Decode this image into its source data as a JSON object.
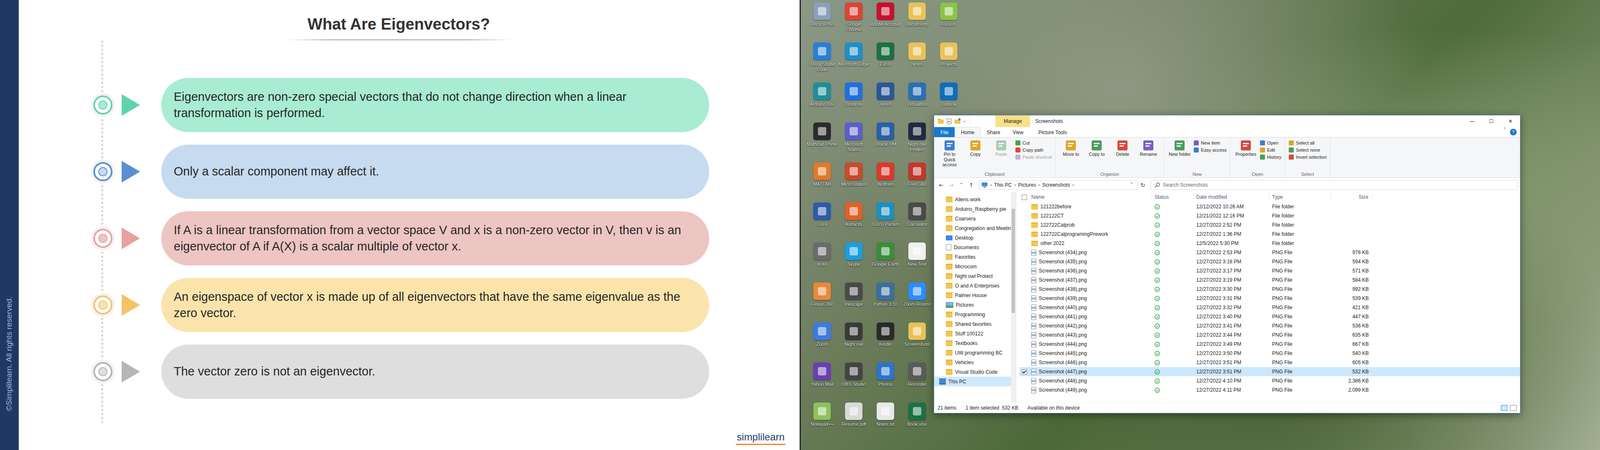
{
  "slide": {
    "title": "What Are Eigenvectors?",
    "watermark": "©Simplilearn. All rights reserved.",
    "logo": "simplilearn",
    "points": [
      {
        "text": "Eigenvectors are non-zero special vectors that do not change direction when a linear transformation is performed.",
        "color": "#a8ecd3",
        "accent": "#5fd3ae"
      },
      {
        "text": "Only a scalar component may affect it.",
        "color": "#c6daf0",
        "accent": "#5a8fd2"
      },
      {
        "text": "If A is a linear transformation from a vector space V and x is a non-zero vector in V, then v is an eigenvector of A if A(X) is a scalar multiple of vector x.",
        "color": "#edc5c2",
        "accent": "#e6a29d"
      },
      {
        "text": "An eigenspace of vector x is made up of all eigenvectors that have the same eigenvalue as the zero vector.",
        "color": "#fbe4ab",
        "accent": "#f5c265"
      },
      {
        "text": "The vector zero is not an eigenvector.",
        "color": "#dedede",
        "accent": "#b5b5b5"
      }
    ]
  },
  "desktop": {
    "icons": [
      {
        "label": "Recycle Bin",
        "color": "#8aa0b8"
      },
      {
        "label": "Visual Studio Code",
        "color": "#2a7fd4"
      },
      {
        "label": "Arduino IDE",
        "color": "#1f8f95"
      },
      {
        "label": "Mathcad Prime",
        "color": "#2b2b2b"
      },
      {
        "label": "MATLAB",
        "color": "#e07a28"
      },
      {
        "label": "Cura",
        "color": "#2f5aa8"
      },
      {
        "label": "Krita",
        "color": "#6b6b6b"
      },
      {
        "label": "Fusion 360",
        "color": "#e8893a"
      },
      {
        "label": "Zoom",
        "color": "#3d7be0"
      },
      {
        "label": "Yahoo Mail",
        "color": "#6b3fb0"
      },
      {
        "label": "Notepad++",
        "color": "#8fc15a"
      },
      {
        "label": "Google Chrome",
        "color": "#db4437"
      },
      {
        "label": "Microsoft Edge",
        "color": "#1e8fc8"
      },
      {
        "label": "Dropbox",
        "color": "#1f6fe0"
      },
      {
        "label": "Microsoft Teams",
        "color": "#5b5fc7"
      },
      {
        "label": "MicroStation",
        "color": "#c94a2c"
      },
      {
        "label": "Audacity",
        "color": "#e0602a"
      },
      {
        "label": "Skype",
        "color": "#18a0e0"
      },
      {
        "label": "Inkscape",
        "color": "#4a4a4a"
      },
      {
        "label": "Night owl",
        "color": "#3a3a3a"
      },
      {
        "label": "OBS Studio",
        "color": "#444444"
      },
      {
        "label": "Resume.pdf",
        "color": "#d9d9d9"
      },
      {
        "label": "Adobe Acrobat",
        "color": "#c8102e"
      },
      {
        "label": "Excel",
        "color": "#1d7044"
      },
      {
        "label": "Word",
        "color": "#2b5797"
      },
      {
        "label": "Oracle VM",
        "color": "#2a5ea8"
      },
      {
        "label": "Wolfram",
        "color": "#d93a2b"
      },
      {
        "label": "Cisco Packet",
        "color": "#1c8fc0"
      },
      {
        "label": "Google Earth",
        "color": "#3b8d3e"
      },
      {
        "label": "Python 3.10",
        "color": "#3b6fa0"
      },
      {
        "label": "Kindle",
        "color": "#2a2a2a"
      },
      {
        "label": "Photos",
        "color": "#2f73c9"
      },
      {
        "label": "Notes.txt",
        "color": "#e8e8e8"
      },
      {
        "label": "Documents",
        "color": "#e8c25a"
      },
      {
        "label": "Notes",
        "color": "#e8c25a"
      },
      {
        "label": "VirtualBox",
        "color": "#2a6fb5"
      },
      {
        "label": "Night owl Protect",
        "color": "#1f2a44"
      },
      {
        "label": "FreeCAD",
        "color": "#c0392b"
      },
      {
        "label": "Calculator",
        "color": "#4a4a4a"
      },
      {
        "label": "New Text",
        "color": "#f0f0f0"
      },
      {
        "label": "Zoom Rooms",
        "color": "#2d8cff"
      },
      {
        "label": "Screenshots",
        "color": "#e8c25a"
      },
      {
        "label": "Recorder",
        "color": "#5a5a5a"
      },
      {
        "label": "Book.xlsx",
        "color": "#1d7044"
      },
      {
        "label": "Fusion",
        "color": "#8bc34a"
      },
      {
        "label": "Projects",
        "color": "#e8c25a"
      },
      {
        "label": "Outlook",
        "color": "#0f6cbd"
      }
    ]
  },
  "explorer": {
    "context_tab": "Manage",
    "title": "Screenshots",
    "controls": [
      "—",
      "☐",
      "✕"
    ],
    "tabs": [
      {
        "label": "File",
        "kind": "file",
        "selected": false
      },
      {
        "label": "Home",
        "kind": "normal",
        "selected": true
      },
      {
        "label": "Share",
        "kind": "normal",
        "selected": false
      },
      {
        "label": "View",
        "kind": "normal",
        "selected": false
      },
      {
        "label": "Picture Tools",
        "kind": "context",
        "selected": false
      }
    ],
    "ribbon_toggle": "˄",
    "help": "?",
    "ribbon": [
      {
        "label": "Clipboard",
        "items": [
          {
            "label": "Pin to Quick access",
            "kind": "large",
            "disabled": false
          },
          {
            "label": "Copy",
            "kind": "large",
            "disabled": false
          },
          {
            "label": "Paste",
            "kind": "large",
            "disabled": true
          },
          {
            "label": "Cut",
            "kind": "small",
            "disabled": false
          },
          {
            "label": "Copy path",
            "kind": "small",
            "disabled": false
          },
          {
            "label": "Paste shortcut",
            "kind": "small",
            "disabled": true
          }
        ]
      },
      {
        "label": "Organize",
        "items": [
          {
            "label": "Move to",
            "kind": "large",
            "disabled": false
          },
          {
            "label": "Copy to",
            "kind": "large",
            "disabled": false
          },
          {
            "label": "Delete",
            "kind": "large",
            "disabled": false
          },
          {
            "label": "Rename",
            "kind": "large",
            "disabled": false
          }
        ]
      },
      {
        "label": "New",
        "items": [
          {
            "label": "New folder",
            "kind": "large",
            "disabled": false
          },
          {
            "label": "New item",
            "kind": "small",
            "disabled": false
          },
          {
            "label": "Easy access",
            "kind": "small",
            "disabled": false
          }
        ]
      },
      {
        "label": "Open",
        "items": [
          {
            "label": "Properties",
            "kind": "large",
            "disabled": false
          },
          {
            "label": "Open",
            "kind": "small",
            "disabled": false
          },
          {
            "label": "Edit",
            "kind": "small",
            "disabled": false
          },
          {
            "label": "History",
            "kind": "small",
            "disabled": false
          }
        ]
      },
      {
        "label": "Select",
        "items": [
          {
            "label": "Select all",
            "kind": "small",
            "disabled": false
          },
          {
            "label": "Select none",
            "kind": "small",
            "disabled": false
          },
          {
            "label": "Invert selection",
            "kind": "small",
            "disabled": false
          }
        ]
      }
    ],
    "nav_buttons": [
      {
        "label": "←",
        "disabled": false
      },
      {
        "label": "→",
        "disabled": true
      },
      {
        "label": "˅",
        "disabled": false
      },
      {
        "label": "↑",
        "disabled": false
      }
    ],
    "breadcrumbs": [
      "This PC",
      "Pictures",
      "Screenshots"
    ],
    "crumb_separator": "›",
    "address_dropdown": "˅",
    "refresh": "↻",
    "search": {
      "placeholder": "Search Screenshots"
    },
    "nav_pane": [
      {
        "label": "Allens work",
        "kind": "folder",
        "selected": false
      },
      {
        "label": "Arduino_Raspberry pie",
        "kind": "folder",
        "selected": false
      },
      {
        "label": "Coarsera",
        "kind": "folder",
        "selected": false
      },
      {
        "label": "Congregation and Meetin",
        "kind": "folder",
        "selected": false
      },
      {
        "label": "Desktop",
        "kind": "desktop",
        "selected": false
      },
      {
        "label": "Documents",
        "kind": "documents",
        "selected": false
      },
      {
        "label": "Favorites",
        "kind": "folder",
        "selected": false
      },
      {
        "label": "Microcom",
        "kind": "folder",
        "selected": false
      },
      {
        "label": "Night owl Protect",
        "kind": "folder",
        "selected": false
      },
      {
        "label": "O and A Enterprises",
        "kind": "folder",
        "selected": false
      },
      {
        "label": "Palmer House",
        "kind": "folder",
        "selected": false
      },
      {
        "label": "Pictures",
        "kind": "pictures",
        "selected": false
      },
      {
        "label": "Programming",
        "kind": "folder",
        "selected": false
      },
      {
        "label": "Shared favorites",
        "kind": "folder",
        "selected": false
      },
      {
        "label": "Stuff 100122",
        "kind": "folder",
        "selected": false
      },
      {
        "label": "Textbooks",
        "kind": "folder",
        "selected": false
      },
      {
        "label": "UW programming BC",
        "kind": "folder",
        "selected": false
      },
      {
        "label": "Vehicles",
        "kind": "folder",
        "selected": false
      },
      {
        "label": "Visual Studio Code",
        "kind": "folder",
        "selected": false
      },
      {
        "label": "This PC",
        "kind": "pc",
        "selected": true
      }
    ],
    "columns": [
      "Name",
      "Status",
      "Date modified",
      "Type",
      "Size"
    ],
    "files": [
      {
        "name": "121222before",
        "kind": "folder",
        "synced": true,
        "date": "12/12/2022 10:26 AM",
        "type": "File folder",
        "size": "",
        "selected": false
      },
      {
        "name": "122122CT",
        "kind": "folder",
        "synced": true,
        "date": "12/21/2022 12:16 PM",
        "type": "File folder",
        "size": "",
        "selected": false
      },
      {
        "name": "122722Calprob",
        "kind": "folder",
        "synced": true,
        "date": "12/27/2022 2:52 PM",
        "type": "File folder",
        "size": "",
        "selected": false
      },
      {
        "name": "122722CalprogramingPrework",
        "kind": "folder",
        "synced": true,
        "date": "12/27/2022 1:36 PM",
        "type": "File folder",
        "size": "",
        "selected": false
      },
      {
        "name": "other 2022",
        "kind": "folder",
        "synced": true,
        "date": "12/5/2022 5:30 PM",
        "type": "File folder",
        "size": "",
        "selected": false
      },
      {
        "name": "Screenshot (434).png",
        "kind": "png",
        "synced": true,
        "date": "12/27/2022 2:53 PM",
        "type": "PNG File",
        "size": "976 KB",
        "selected": false
      },
      {
        "name": "Screenshot (435).png",
        "kind": "png",
        "synced": true,
        "date": "12/27/2022 3:16 PM",
        "type": "PNG File",
        "size": "594 KB",
        "selected": false
      },
      {
        "name": "Screenshot (436).png",
        "kind": "png",
        "synced": true,
        "date": "12/27/2022 3:17 PM",
        "type": "PNG File",
        "size": "571 KB",
        "selected": false
      },
      {
        "name": "Screenshot (437).png",
        "kind": "png",
        "synced": true,
        "date": "12/27/2022 3:19 PM",
        "type": "PNG File",
        "size": "584 KB",
        "selected": false
      },
      {
        "name": "Screenshot (438).png",
        "kind": "png",
        "synced": true,
        "date": "12/27/2022 3:30 PM",
        "type": "PNG File",
        "size": "992 KB",
        "selected": false
      },
      {
        "name": "Screenshot (439).png",
        "kind": "png",
        "synced": true,
        "date": "12/27/2022 3:31 PM",
        "type": "PNG File",
        "size": "539 KB",
        "selected": false
      },
      {
        "name": "Screenshot (440).png",
        "kind": "png",
        "synced": true,
        "date": "12/27/2022 3:32 PM",
        "type": "PNG File",
        "size": "421 KB",
        "selected": false
      },
      {
        "name": "Screenshot (441).png",
        "kind": "png",
        "synced": true,
        "date": "12/27/2022 3:40 PM",
        "type": "PNG File",
        "size": "447 KB",
        "selected": false
      },
      {
        "name": "Screenshot (442).png",
        "kind": "png",
        "synced": true,
        "date": "12/27/2022 3:41 PM",
        "type": "PNG File",
        "size": "536 KB",
        "selected": false
      },
      {
        "name": "Screenshot (443).png",
        "kind": "png",
        "synced": true,
        "date": "12/27/2022 3:44 PM",
        "type": "PNG File",
        "size": "635 KB",
        "selected": false
      },
      {
        "name": "Screenshot (444).png",
        "kind": "png",
        "synced": true,
        "date": "12/27/2022 3:49 PM",
        "type": "PNG File",
        "size": "667 KB",
        "selected": false
      },
      {
        "name": "Screenshot (445).png",
        "kind": "png",
        "synced": true,
        "date": "12/27/2022 3:50 PM",
        "type": "PNG File",
        "size": "540 KB",
        "selected": false
      },
      {
        "name": "Screenshot (446).png",
        "kind": "png",
        "synced": true,
        "date": "12/27/2022 3:51 PM",
        "type": "PNG File",
        "size": "605 KB",
        "selected": false
      },
      {
        "name": "Screenshot (447).png",
        "kind": "png",
        "synced": true,
        "date": "12/27/2022 3:51 PM",
        "type": "PNG File",
        "size": "532 KB",
        "selected": true
      },
      {
        "name": "Screenshot (448).png",
        "kind": "png",
        "synced": true,
        "date": "12/27/2022 4:10 PM",
        "type": "PNG File",
        "size": "2,386 KB",
        "selected": false
      },
      {
        "name": "Screenshot (449).png",
        "kind": "png",
        "synced": true,
        "date": "12/27/2022 4:11 PM",
        "type": "PNG File",
        "size": "2,099 KB",
        "selected": false
      }
    ],
    "status_bar": {
      "count": "21 items",
      "selection": "1 item selected  532 KB",
      "availability": "Available on this device"
    }
  }
}
